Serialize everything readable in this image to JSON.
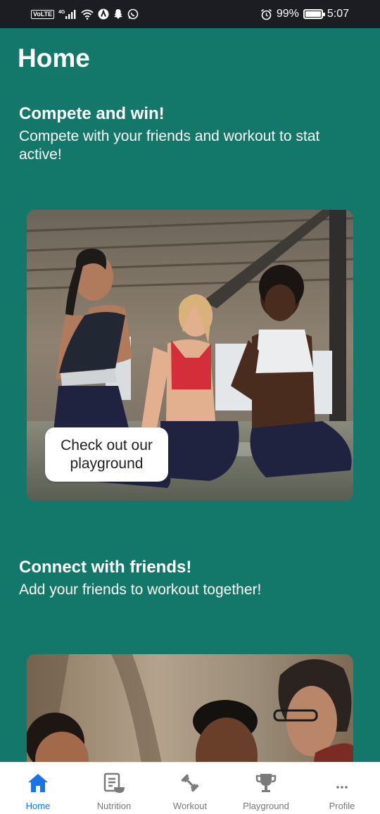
{
  "status_bar": {
    "network": "4G",
    "battery": "99%",
    "battery_level": 0.99,
    "time": "5:07",
    "volte": "VoLTE"
  },
  "page": {
    "title": "Home"
  },
  "sections": [
    {
      "heading": "Compete and win!",
      "subtitle": "Compete with your friends and workout to stat active!",
      "cta": "Check out our playground"
    },
    {
      "heading": "Connect with friends!",
      "subtitle": "Add your friends to workout together!"
    }
  ],
  "nav": {
    "active": "home",
    "active_color": "#1a73e8",
    "items": [
      {
        "label": "Home",
        "icon": "home-icon"
      },
      {
        "label": "Nutrition",
        "icon": "nutrition-icon"
      },
      {
        "label": "Workout",
        "icon": "dumbbell-icon"
      },
      {
        "label": "Playground",
        "icon": "trophy-icon"
      },
      {
        "label": "Profile",
        "icon": "more-icon"
      }
    ]
  },
  "colors": {
    "background": "#13776a",
    "status_bar": "#1b1d22"
  }
}
